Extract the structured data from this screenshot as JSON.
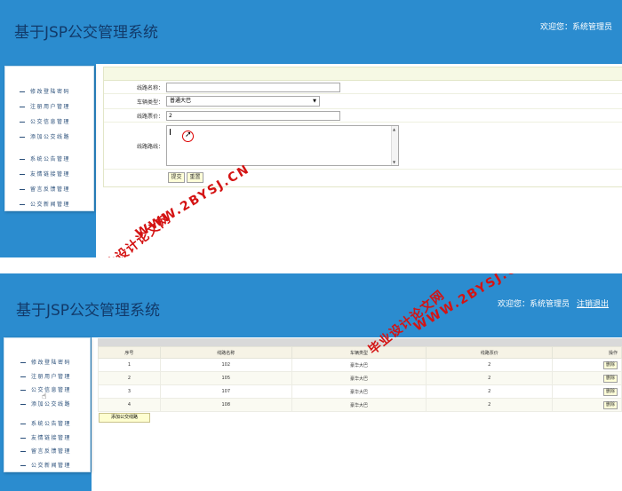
{
  "app": {
    "title": "基于JSP公交管理系统",
    "welcome": "欢迎您：系统管理员",
    "logout": "注销退出"
  },
  "sidebar": {
    "items": [
      {
        "label": "修改登陆密码"
      },
      {
        "label": "注册用户管理"
      },
      {
        "label": "公交信息管理"
      },
      {
        "label": "添加公交线路"
      },
      {
        "label": "系统公告管理"
      },
      {
        "label": "友情链接管理"
      },
      {
        "label": "留言反馈管理"
      },
      {
        "label": "公交新闻管理"
      }
    ]
  },
  "form": {
    "route_name": {
      "label": "线路名称：",
      "value": ""
    },
    "vehicle_type": {
      "label": "车辆类型：",
      "value": "普通大巴"
    },
    "fare": {
      "label": "线路票价：",
      "value": "2"
    },
    "route": {
      "label": "线路路线：",
      "value": ""
    },
    "submit_label": "提交",
    "reset_label": "重置"
  },
  "table": {
    "headers": [
      "序号",
      "线路名称",
      "车辆类型",
      "线路票价",
      "操作"
    ],
    "rows": [
      {
        "no": "1",
        "name": "102",
        "type": "豪华大巴",
        "fare": "2",
        "action": "删除"
      },
      {
        "no": "2",
        "name": "105",
        "type": "豪华大巴",
        "fare": "2",
        "action": "删除"
      },
      {
        "no": "3",
        "name": "107",
        "type": "豪华大巴",
        "fare": "2",
        "action": "删除"
      },
      {
        "no": "4",
        "name": "108",
        "type": "豪华大巴",
        "fare": "2",
        "action": "删除"
      }
    ],
    "add_button": "添加公交线路"
  },
  "watermark": {
    "site": "WWW.2BYSJ.CN",
    "name": "毕业设计论文网"
  },
  "colors": {
    "header": "#2b8ccf",
    "title": "#123a6a",
    "watermark": "#d41313"
  }
}
